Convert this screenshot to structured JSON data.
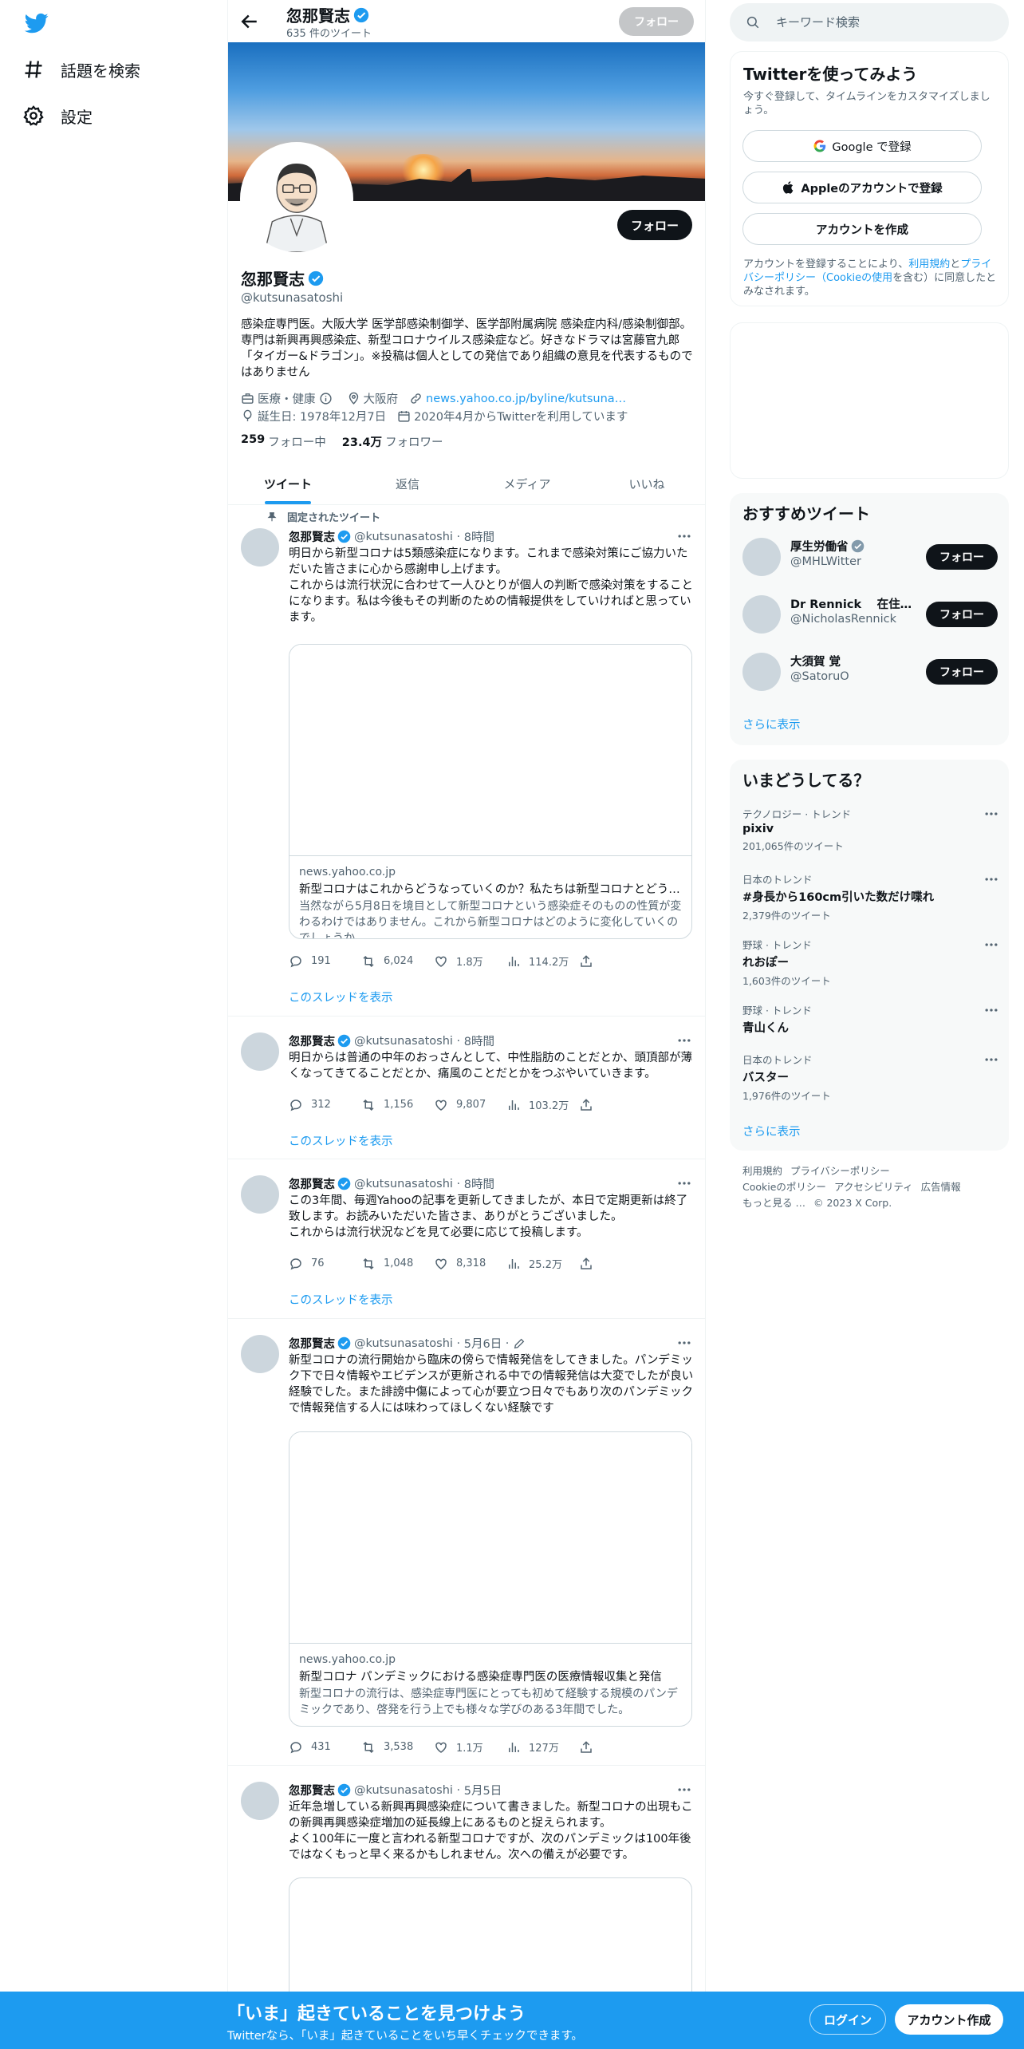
{
  "colors": {
    "accent": "#1d9bf0",
    "text": "#0f1419",
    "muted": "#536471",
    "border": "#eff3f4"
  },
  "nav": {
    "logo": "twitter-bird-icon",
    "items": [
      {
        "label": "話題を検索",
        "icon": "hashtag-icon"
      },
      {
        "label": "設定",
        "icon": "gear-icon"
      }
    ]
  },
  "header": {
    "name": "忽那賢志",
    "tweet_count": "635 件のツイート",
    "follow": "フォロー"
  },
  "profile": {
    "name": "忽那賢志",
    "handle": "@kutsunasatoshi",
    "follow": "フォロー",
    "bio": "感染症専門医。大阪大学 医学部感染制御学、医学部附属病院 感染症内科/感染制御部。専門は新興再興感染症、新型コロナウイルス感染症など。好きなドラマは宮藤官九郎「タイガー&ドラゴン」。※投稿は個人としての発信であり組織の意見を代表するものではありません",
    "category": "医療・健康",
    "location": "大阪府",
    "url": "news.yahoo.co.jp/byline/kutsuna…",
    "birthday": "誕生日: 1978年12月7日",
    "joined": "2020年4月からTwitterを利用しています",
    "following_count": "259",
    "following_label": "フォロー中",
    "followers_count": "23.4万",
    "followers_label": "フォロワー"
  },
  "tabs": [
    "ツイート",
    "返信",
    "メディア",
    "いいね"
  ],
  "pinned_label": "固定されたツイート",
  "tweets": [
    {
      "name": "忽那賢志",
      "handle": "@kutsunasatoshi",
      "time": "8時間",
      "text": "明日から新型コロナは5類感染症になります。これまで感染対策にご協力いただいた皆さまに心から感謝申し上げます。\nこれからは流行状況に合わせて一人ひとりが個人の判断で感染対策をすることになります。私は今後もその判断のための情報提供をしていければと思っています。",
      "card": {
        "domain": "news.yahoo.co.jp",
        "title": "新型コロナはこれからどうなっていくのか？私たちは新型コロナとどう向き合っていけばよいのか",
        "desc": "当然ながら5月8日を境目として新型コロナという感染症そのものの性質が変わるわけではありません。これから新型コロナはどのように変化していくのでしょうか。"
      },
      "replies": "191",
      "retweets": "6,024",
      "likes": "1.8万",
      "views": "114.2万",
      "thread": "このスレッドを表示"
    },
    {
      "name": "忽那賢志",
      "handle": "@kutsunasatoshi",
      "time": "8時間",
      "text": "明日からは普通の中年のおっさんとして、中性脂肪のことだとか、頭頂部が薄くなってきてることだとか、痛風のことだとかをつぶやいていきます。",
      "replies": "312",
      "retweets": "1,156",
      "likes": "9,807",
      "views": "103.2万",
      "thread": "このスレッドを表示"
    },
    {
      "name": "忽那賢志",
      "handle": "@kutsunasatoshi",
      "time": "8時間",
      "text": "この3年間、毎週Yahooの記事を更新してきましたが、本日で定期更新は終了致します。お読みいただいた皆さま、ありがとうございました。\nこれからは流行状況などを見て必要に応じて投稿します。",
      "replies": "76",
      "retweets": "1,048",
      "likes": "8,318",
      "views": "25.2万",
      "thread": "このスレッドを表示"
    },
    {
      "name": "忽那賢志",
      "handle": "@kutsunasatoshi",
      "time": "5月6日",
      "text": "新型コロナの流行開始から臨床の傍らで情報発信をしてきました。パンデミック下で日々情報やエビデンスが更新される中での情報発信は大変でしたが良い経験でした。また誹謗中傷によって心が要立つ日々でもあり次のパンデミックで情報発信する人には味わってほしくない経験です",
      "card": {
        "domain": "news.yahoo.co.jp",
        "title": "新型コロナ パンデミックにおける感染症専門医の医療情報収集と発信",
        "desc": "新型コロナの流行は、感染症専門医にとっても初めて経験する規模のパンデミックであり、啓発を行う上でも様々な学びのある3年間でした。"
      },
      "replies": "431",
      "retweets": "3,538",
      "likes": "1.1万",
      "views": "127万"
    },
    {
      "name": "忽那賢志",
      "handle": "@kutsunasatoshi",
      "time": "5月5日",
      "text": "近年急増している新興再興感染症について書きました。新型コロナの出現もこの新興再興感染症増加の延長線上にあるものと捉えられます。\nよく100年に一度と言われる新型コロナですが、次のパンデミックは100年後ではなくもっと早く来るかもしれません。次への備えが必要です。"
    }
  ],
  "search": {
    "placeholder": "キーワード検索"
  },
  "join": {
    "title": "Twitterを使ってみよう",
    "subtitle": "今すぐ登録して、タイムラインをカスタマイズしましょう。",
    "google": "Google で登録",
    "apple": "Appleのアカウントで登録",
    "create": "アカウントを作成",
    "legal_1": "アカウントを登録することにより、",
    "legal_terms": "利用規約",
    "legal_2": "と",
    "legal_privacy": "プライバシーポリシー（Cookieの使用",
    "legal_3": "を含む）に同意したとみなされます。"
  },
  "recommend": {
    "title": "おすすめツイート",
    "follow": "フォロー",
    "more": "さらに表示",
    "users": [
      {
        "name": "厚生労働省",
        "handle": "@MHLWitter",
        "verified": true
      },
      {
        "name": "Dr Rennick　 在住…",
        "handle": "@NicholasRennick",
        "verified": false
      },
      {
        "name": "大須賀 覚",
        "handle": "@SatoruO",
        "verified": false
      }
    ]
  },
  "trends": {
    "title": "いまどうしてる？",
    "more": "さらに表示",
    "items": [
      {
        "context": "テクノロジー · トレンド",
        "name": "pixiv",
        "count": "201,065件のツイート"
      },
      {
        "context": "日本のトレンド",
        "name": "#身長から160cm引いた数だけ喋れ",
        "count": "2,379件のツイート"
      },
      {
        "context": "野球 · トレンド",
        "name": "れおぽー",
        "count": "1,603件のツイート"
      },
      {
        "context": "野球 · トレンド",
        "name": "青山くん",
        "count": ""
      },
      {
        "context": "日本のトレンド",
        "name": "バスター",
        "count": "1,976件のツイート"
      }
    ]
  },
  "footer": {
    "links": [
      "利用規約",
      "プライバシーポリシー",
      "Cookieのポリシー",
      "アクセシビリティ",
      "広告情報",
      "もっと見る …",
      "© 2023 X Corp."
    ]
  },
  "bottom": {
    "title": "「いま」起きていることを見つけよう",
    "subtitle": "Twitterなら、「いま」起きていることをいち早くチェックできます。",
    "login": "ログイン",
    "signup": "アカウント作成"
  }
}
